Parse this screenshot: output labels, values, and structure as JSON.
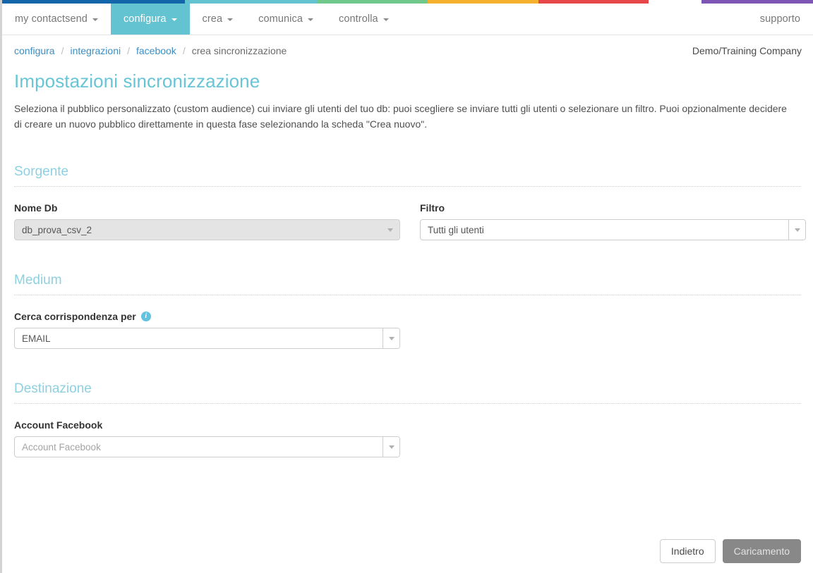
{
  "colorStrip": [
    {
      "name": "blue",
      "color": "#1466ab",
      "flex": 24.0
    },
    {
      "name": "teal",
      "color": "#63c3d1",
      "flex": 17.4
    },
    {
      "name": "green",
      "color": "#70c98a",
      "flex": 14.5
    },
    {
      "name": "yellow",
      "color": "#f5b02d",
      "flex": 14.5
    },
    {
      "name": "red",
      "color": "#e8474a",
      "flex": 14.5
    },
    {
      "name": "white",
      "color": "#ffffff",
      "flex": 7.0
    },
    {
      "name": "purple",
      "color": "#7d55b5",
      "flex": 14.6
    }
  ],
  "nav": {
    "items": [
      {
        "label": "my contactsend",
        "caret": true,
        "active": false
      },
      {
        "label": "configura",
        "caret": true,
        "active": true
      },
      {
        "label": "crea",
        "caret": true,
        "active": false
      },
      {
        "label": "comunica",
        "caret": true,
        "active": false
      },
      {
        "label": "controlla",
        "caret": true,
        "active": false
      }
    ],
    "support": {
      "label": "supporto",
      "caret": false
    }
  },
  "breadcrumb": {
    "items": [
      {
        "label": "configura",
        "link": true
      },
      {
        "label": "integrazioni",
        "link": true
      },
      {
        "label": "facebook",
        "link": true
      },
      {
        "label": "crea sincronizzazione",
        "link": false
      }
    ],
    "separator": "/"
  },
  "company": "Demo/Training Company",
  "page": {
    "title": "Impostazioni sincronizzazione",
    "description": "Seleziona il pubblico personalizzato (custom audience) cui inviare gli utenti del tuo db: puoi scegliere se inviare tutti gli utenti o selezionare un filtro. Puoi opzionalmente decidere di creare un nuovo pubblico direttamente in questa fase selezionando la scheda \"Crea nuovo\"."
  },
  "sections": {
    "sorgente": {
      "title": "Sorgente",
      "nomeDb": {
        "label": "Nome Db",
        "value": "db_prova_csv_2",
        "disabled": true
      },
      "filtro": {
        "label": "Filtro",
        "value": "Tutti gli utenti",
        "disabled": false
      }
    },
    "medium": {
      "title": "Medium",
      "cerca": {
        "label": "Cerca corrispondenza per",
        "info_icon": "info-icon",
        "info_glyph": "i",
        "value": "EMAIL",
        "disabled": false
      }
    },
    "destinazione": {
      "title": "Destinazione",
      "accountFacebook": {
        "label": "Account Facebook",
        "placeholder": "Account Facebook",
        "value": "",
        "disabled": false
      }
    }
  },
  "footer": {
    "back_label": "Indietro",
    "submit_label": "Caricamento"
  },
  "colors": {
    "accent_teal": "#63c3d1",
    "heading_teal": "#68c5d6",
    "section_teal": "#8dd1e0",
    "link_blue": "#3b8fc4"
  }
}
